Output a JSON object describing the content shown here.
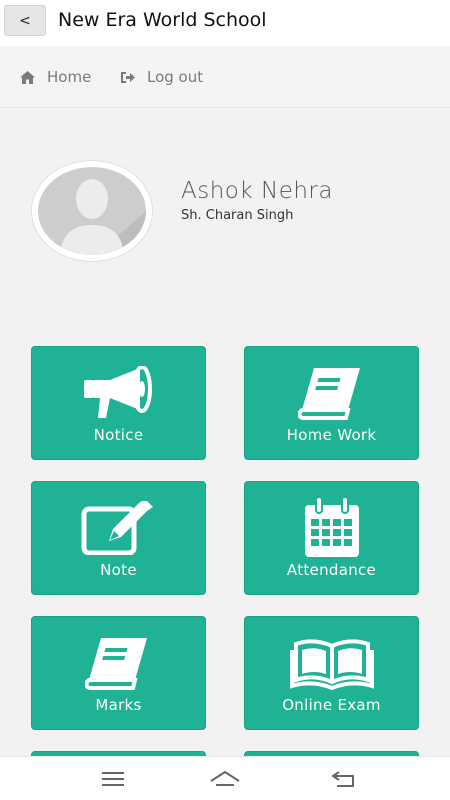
{
  "header": {
    "back_label": "<",
    "title": "New Era World School"
  },
  "nav": {
    "home": "Home",
    "logout": "Log out"
  },
  "profile": {
    "name": "Ashok Nehra",
    "parent": "Sh. Charan Singh"
  },
  "tiles": [
    {
      "label": "Notice",
      "icon": "megaphone-icon"
    },
    {
      "label": "Home Work",
      "icon": "book-icon"
    },
    {
      "label": "Note",
      "icon": "edit-note-icon"
    },
    {
      "label": "Attendance",
      "icon": "calendar-icon"
    },
    {
      "label": "Marks",
      "icon": "book-icon"
    },
    {
      "label": "Online Exam",
      "icon": "open-book-icon"
    }
  ],
  "colors": {
    "tile": "#1fb294",
    "background": "#f2f2f2",
    "nav_text": "#7a7a7a"
  },
  "system_nav": [
    "menu-icon",
    "home-icon",
    "back-icon"
  ]
}
